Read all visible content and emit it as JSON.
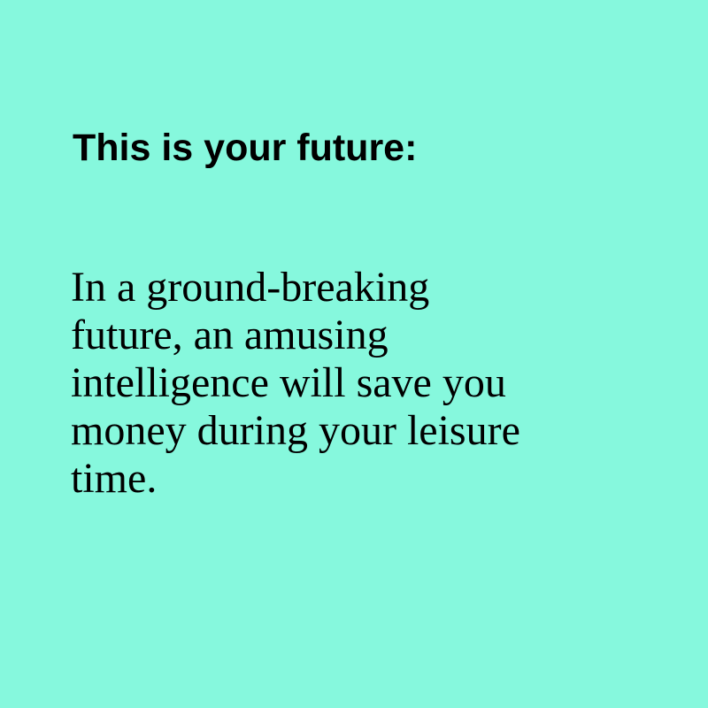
{
  "colors": {
    "background": "#86f8dd",
    "text": "#000000"
  },
  "heading": "This is your future:",
  "body_lines": [
    "In a ground-breaking",
    "future, an amusing",
    "intelligence will save you",
    "money during your leisure",
    "time."
  ]
}
